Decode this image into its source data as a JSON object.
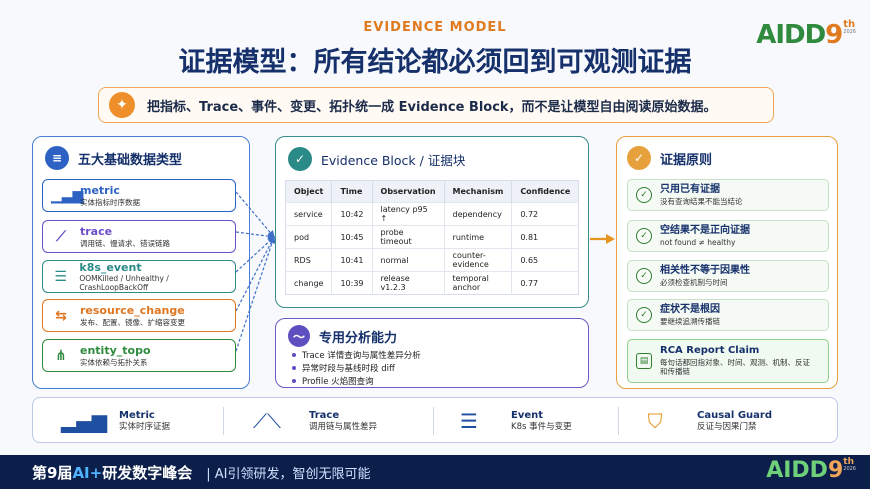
{
  "header": {
    "eyebrow": "EVIDENCE MODEL",
    "title": "证据模型：所有结论都必须回到可观测证据"
  },
  "logo": {
    "text": "AIDD",
    "sup": "9",
    "th": "th",
    "year": "2026"
  },
  "banner": {
    "text": "把指标、Trace、事件、变更、拓扑统一成 Evidence Block，而不是让模型自由阅读原始数据。"
  },
  "data_types": {
    "title": "五大基础数据类型",
    "items": [
      {
        "name": "metric",
        "desc": "实体指标时序数据",
        "color": "#2d62c4",
        "icon": "bar-chart-icon"
      },
      {
        "name": "trace",
        "desc": "调用链、慢请求、错误链路",
        "color": "#6a4fc8",
        "icon": "trace-icon"
      },
      {
        "name": "k8s_event",
        "desc": "OOMKilled / Unhealthy / CrashLoopBackOff",
        "color": "#2a8a87",
        "icon": "event-list-icon"
      },
      {
        "name": "resource_change",
        "desc": "发布、配置、镜像、扩缩容变更",
        "color": "#e0761f",
        "icon": "change-icon"
      },
      {
        "name": "entity_topo",
        "desc": "实体依赖与拓扑关系",
        "color": "#2f8a3e",
        "icon": "topology-icon"
      }
    ]
  },
  "evidence_block": {
    "title": "Evidence Block / 证据块",
    "columns": [
      "Object",
      "Time",
      "Observation",
      "Mechanism",
      "Confidence"
    ],
    "rows": [
      [
        "service",
        "10:42",
        "latency p95 ↑",
        "dependency",
        "0.72"
      ],
      [
        "pod",
        "10:45",
        "probe timeout",
        "runtime",
        "0.81"
      ],
      [
        "RDS",
        "10:41",
        "normal",
        "counter-evidence",
        "0.65"
      ],
      [
        "change",
        "10:39",
        "release v1.2.3",
        "temporal anchor",
        "0.77"
      ]
    ]
  },
  "analysis": {
    "title": "专用分析能力",
    "items": [
      "Trace 详情查询与属性差异分析",
      "异常时段与基线时段 diff",
      "Profile 火焰图查询"
    ]
  },
  "principles": {
    "title": "证据原则",
    "items": [
      {
        "title": "只用已有证据",
        "desc": "没有查询结果不能当结论"
      },
      {
        "title": "空结果不是正向证据",
        "desc": "not found ≠ healthy"
      },
      {
        "title": "相关性不等于因果性",
        "desc": "必须检查机制与时间"
      },
      {
        "title": "症状不是根因",
        "desc": "要继续追溯传播链"
      },
      {
        "title": "RCA Report Claim",
        "desc": "每句话都回指对象、时间、观测、机制、反证和传播链"
      }
    ]
  },
  "features": [
    {
      "title": "Metric",
      "desc": "实体时序证据",
      "icon": "bar-chart-icon"
    },
    {
      "title": "Trace",
      "desc": "调用链与属性差异",
      "icon": "trace-icon"
    },
    {
      "title": "Event",
      "desc": "K8s 事件与变更",
      "icon": "event-list-icon"
    },
    {
      "title": "Causal Guard",
      "desc": "反证与因果门禁",
      "icon": "shield-check-icon"
    }
  ],
  "footer": {
    "conf_prefix": "第9届",
    "conf_ai": "AI+",
    "conf_suffix": "研发数字峰会",
    "slogan": "| AI引领研发，智创无限可能"
  },
  "colors": {
    "navy": "#15306b",
    "orange": "#e07a1f",
    "teal": "#3a8d8d",
    "green": "#2e7d32"
  }
}
